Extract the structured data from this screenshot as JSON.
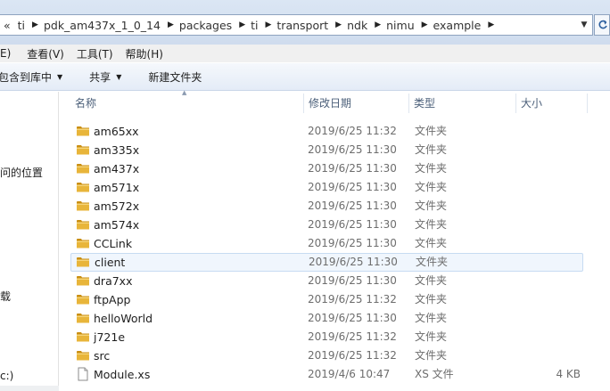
{
  "address": {
    "lead": "«",
    "crumbs": [
      "ti",
      "pdk_am437x_1_0_14",
      "packages",
      "ti",
      "transport",
      "ndk",
      "nimu",
      "example"
    ]
  },
  "menu": {
    "items": [
      "E)",
      "查看(V)",
      "工具(T)",
      "帮助(H)"
    ]
  },
  "toolbar": {
    "include_library": "包含到库中",
    "share": "共享",
    "new_folder": "新建文件夹"
  },
  "nav": {
    "items": [
      "问的位置",
      "载",
      "c:)"
    ]
  },
  "columns": {
    "name": "名称",
    "date": "修改日期",
    "type": "类型",
    "size": "大小"
  },
  "files": [
    {
      "name": "am65xx",
      "date": "2019/6/25 11:32",
      "type": "文件夹",
      "size": "",
      "kind": "folder"
    },
    {
      "name": "am335x",
      "date": "2019/6/25 11:30",
      "type": "文件夹",
      "size": "",
      "kind": "folder"
    },
    {
      "name": "am437x",
      "date": "2019/6/25 11:30",
      "type": "文件夹",
      "size": "",
      "kind": "folder"
    },
    {
      "name": "am571x",
      "date": "2019/6/25 11:30",
      "type": "文件夹",
      "size": "",
      "kind": "folder"
    },
    {
      "name": "am572x",
      "date": "2019/6/25 11:30",
      "type": "文件夹",
      "size": "",
      "kind": "folder"
    },
    {
      "name": "am574x",
      "date": "2019/6/25 11:30",
      "type": "文件夹",
      "size": "",
      "kind": "folder"
    },
    {
      "name": "CCLink",
      "date": "2019/6/25 11:30",
      "type": "文件夹",
      "size": "",
      "kind": "folder"
    },
    {
      "name": "client",
      "date": "2019/6/25 11:30",
      "type": "文件夹",
      "size": "",
      "kind": "folder",
      "selected": true
    },
    {
      "name": "dra7xx",
      "date": "2019/6/25 11:30",
      "type": "文件夹",
      "size": "",
      "kind": "folder"
    },
    {
      "name": "ftpApp",
      "date": "2019/6/25 11:32",
      "type": "文件夹",
      "size": "",
      "kind": "folder"
    },
    {
      "name": "helloWorld",
      "date": "2019/6/25 11:30",
      "type": "文件夹",
      "size": "",
      "kind": "folder"
    },
    {
      "name": "j721e",
      "date": "2019/6/25 11:32",
      "type": "文件夹",
      "size": "",
      "kind": "folder"
    },
    {
      "name": "src",
      "date": "2019/6/25 11:32",
      "type": "文件夹",
      "size": "",
      "kind": "folder"
    },
    {
      "name": "Module.xs",
      "date": "2019/4/6 10:47",
      "type": "XS 文件",
      "size": "4 KB",
      "kind": "file"
    }
  ],
  "colors": {
    "folder": "#e8b53a",
    "folder_dark": "#c98e12",
    "selection_bg": "#f0f6fd",
    "selection_border": "#c7dbf2",
    "header_text": "#4c607a"
  }
}
